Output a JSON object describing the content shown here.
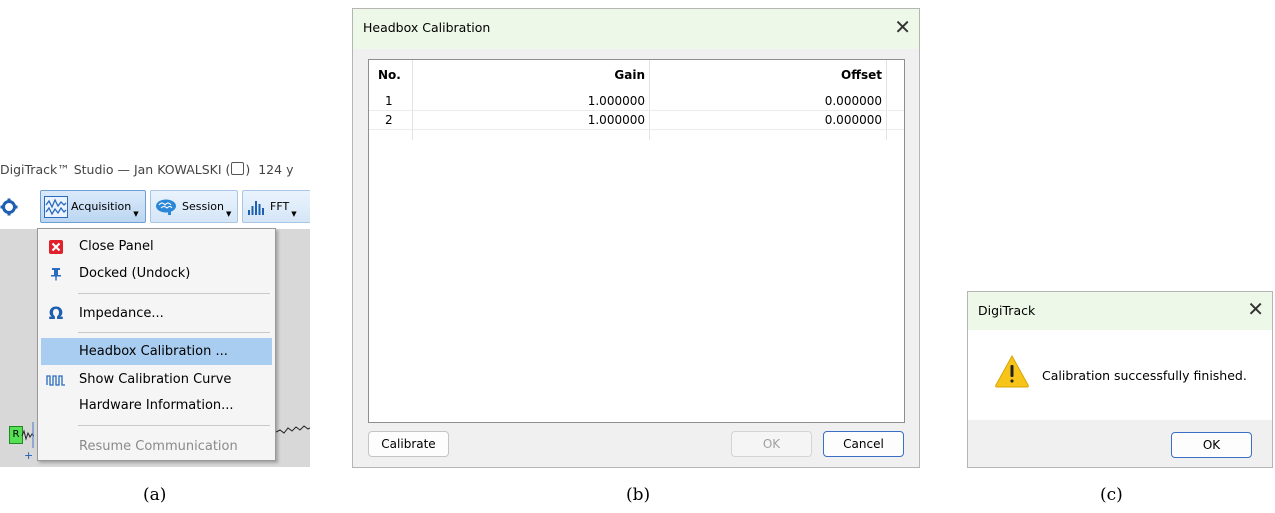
{
  "panel_a": {
    "window_title": "DigiTrack™ Studio — Jan KOWALSKI (",
    "window_title_suffix": "124 y",
    "toolbar": {
      "acquisition": "Acquisition",
      "session": "Session",
      "fft": "FFT"
    },
    "menu": {
      "items": [
        {
          "label": "Close Panel",
          "icon": "close-red-x-icon"
        },
        {
          "label": "Docked (Undock)",
          "icon": "pin-icon"
        },
        {
          "label": "Impedance...",
          "icon": "omega-icon"
        },
        {
          "label": "Headbox Calibration ...",
          "icon": "",
          "selected": true
        },
        {
          "label": "Show Calibration Curve",
          "icon": "calibration-curve-icon"
        },
        {
          "label": "Hardware Information...",
          "icon": ""
        },
        {
          "label": "Resume Communication",
          "icon": "",
          "disabled": true
        }
      ]
    },
    "eeg_marker": "R",
    "eeg_plus": "+"
  },
  "panel_b": {
    "title": "Headbox Calibration",
    "columns": [
      "No.",
      "Gain",
      "Offset"
    ],
    "rows": [
      {
        "no": "1",
        "gain": "1.000000",
        "offset": "0.000000"
      },
      {
        "no": "2",
        "gain": "1.000000",
        "offset": "0.000000"
      }
    ],
    "buttons": {
      "calibrate": "Calibrate",
      "ok": "OK",
      "cancel": "Cancel"
    }
  },
  "panel_c": {
    "title": "DigiTrack",
    "message": "Calibration successfully finished.",
    "ok": "OK",
    "icon": "warning-icon"
  },
  "captions": {
    "a": "(a)",
    "b": "(b)",
    "c": "(c)"
  },
  "colors": {
    "menu_highlight": "#a8cdf0",
    "dialog_titlebar": "#eef8e8",
    "default_button_border": "#3a6fc4",
    "warning_yellow": "#f7c51a"
  }
}
